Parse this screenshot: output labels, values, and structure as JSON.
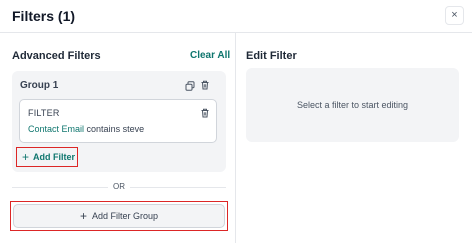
{
  "header": {
    "title": "Filters (1)",
    "close_icon": "×"
  },
  "left": {
    "section_title": "Advanced Filters",
    "clear_all_label": "Clear All",
    "group": {
      "title": "Group 1",
      "copy_icon": "copy-icon",
      "delete_icon": "trash-icon",
      "filter": {
        "label": "FILTER",
        "field": "Contact Email",
        "operator": "contains",
        "value": "steve",
        "delete_icon": "trash-icon"
      },
      "add_filter_label": "Add Filter"
    },
    "or_label": "OR",
    "add_group_label": "Add Filter Group"
  },
  "right": {
    "title": "Edit Filter",
    "placeholder": "Select a filter to start editing"
  },
  "colors": {
    "accent": "#0f766e",
    "highlight": "#dc2626"
  }
}
